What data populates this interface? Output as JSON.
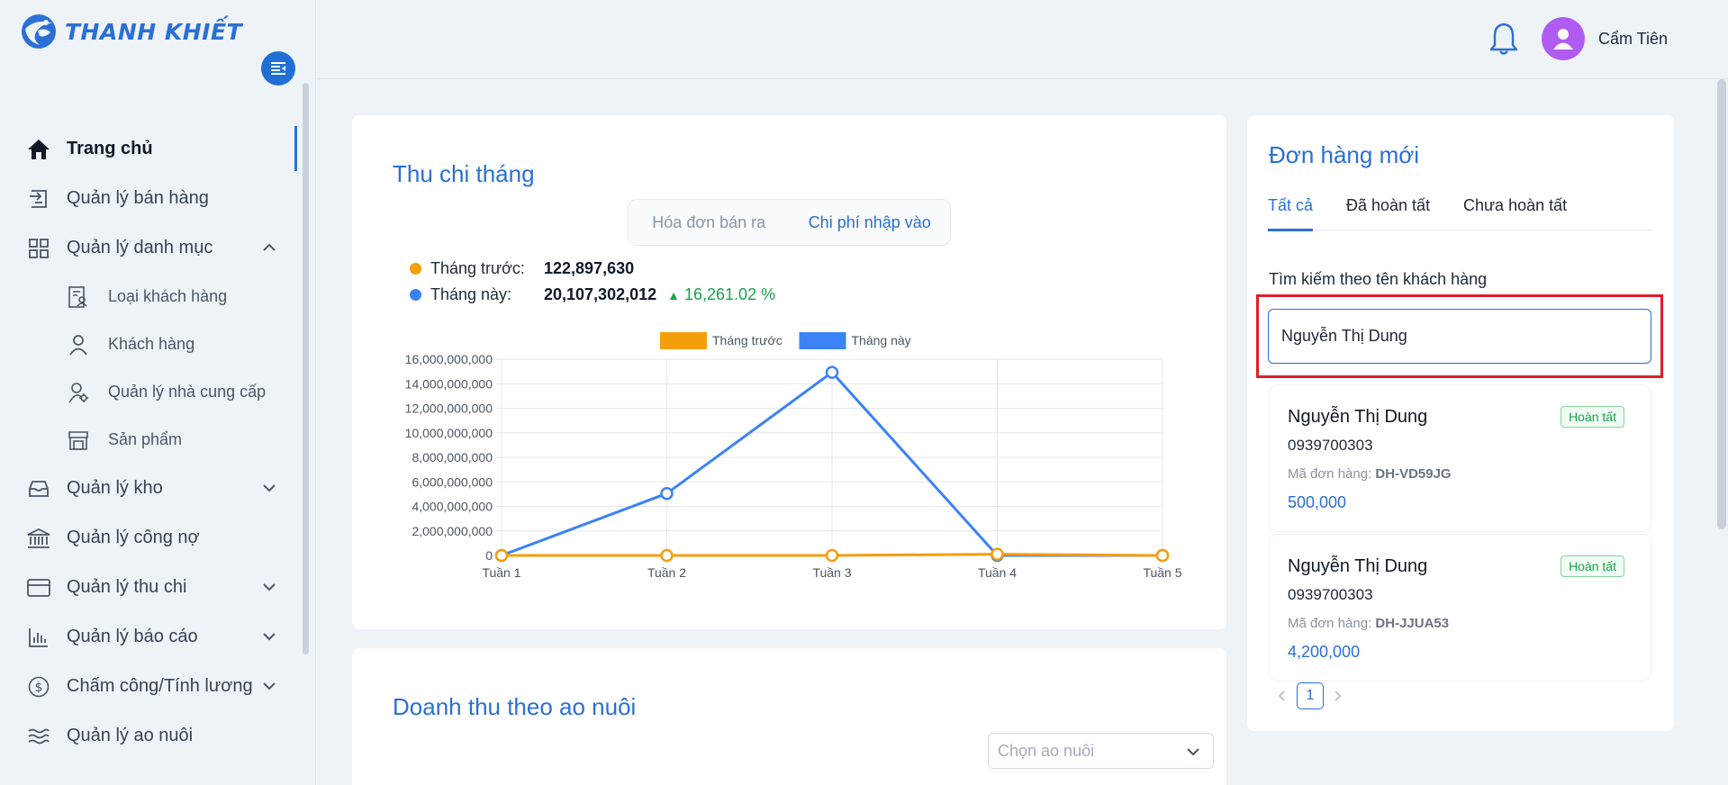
{
  "brand": {
    "name": "THANH KHIẾT",
    "color": "#2b6fd6"
  },
  "sidebar": {
    "items": [
      {
        "label": "Trang chủ",
        "icon": "home-icon",
        "active": true
      },
      {
        "label": "Quản lý bán hàng",
        "icon": "sales-icon"
      },
      {
        "label": "Quản lý danh mục",
        "icon": "grid-icon",
        "expanded": true,
        "children": [
          {
            "label": "Loại khách hàng",
            "icon": "customer-type-icon"
          },
          {
            "label": "Khách hàng",
            "icon": "user-icon"
          },
          {
            "label": "Quản lý nhà cung cấp",
            "icon": "supplier-icon"
          },
          {
            "label": "Sản phẩm",
            "icon": "store-icon"
          }
        ]
      },
      {
        "label": "Quản lý kho",
        "icon": "inbox-icon"
      },
      {
        "label": "Quản lý công nợ",
        "icon": "bank-icon"
      },
      {
        "label": "Quản lý thu chi",
        "icon": "card-icon"
      },
      {
        "label": "Quản lý báo cáo",
        "icon": "bar-chart-icon"
      },
      {
        "label": "Chấm công/Tính lương",
        "icon": "dollar-icon"
      },
      {
        "label": "Quản lý ao nuôi",
        "icon": "waves-icon"
      }
    ]
  },
  "header": {
    "username": "Cẩm Tiên",
    "avatar_color": "#b05cf0"
  },
  "finance": {
    "title": "Thu chi tháng",
    "toggle": {
      "option1": "Hóa đơn bán ra",
      "option2": "Chi phí nhập vào",
      "selected": "Chi phí nhập vào"
    },
    "prev_label": "Tháng trước:",
    "prev_value": "122,897,630",
    "curr_label": "Tháng này:",
    "curr_value": "20,107,302,012",
    "change": "16,261.02 %"
  },
  "chart_data": {
    "type": "line",
    "categories": [
      "Tuần 1",
      "Tuần 2",
      "Tuần 3",
      "Tuần 4",
      "Tuần 5"
    ],
    "series": [
      {
        "name": "Tháng trước",
        "color": "#f59e0b",
        "values": [
          0,
          0,
          0,
          100000000,
          0
        ]
      },
      {
        "name": "Tháng này",
        "color": "#3b82f6",
        "values": [
          0,
          5050000000,
          14930000000,
          0,
          0
        ]
      }
    ],
    "yticks": [
      "16,000,000,000",
      "14,000,000,000",
      "12,000,000,000",
      "10,000,000,000",
      "8,000,000,000",
      "6,000,000,000",
      "4,000,000,000",
      "2,000,000,000",
      "0"
    ],
    "ylim": [
      0,
      16000000000
    ],
    "legend_position": "top",
    "grid": true
  },
  "revenue": {
    "title": "Doanh thu theo ao nuôi",
    "select_placeholder": "Chọn ao nuôi"
  },
  "orders": {
    "title": "Đơn hàng mới",
    "tabs": [
      "Tất cả",
      "Đã hoàn tất",
      "Chưa hoàn tất"
    ],
    "search_label": "Tìm kiếm theo tên khách hàng",
    "search_value": "Nguyễn Thị Dung",
    "code_label": "Mã đơn hàng:",
    "items": [
      {
        "name": "Nguyễn Thị Dung",
        "phone": "0939700303",
        "code": "DH-VD59JG",
        "amount": "500,000",
        "status": "Hoàn tất"
      },
      {
        "name": "Nguyễn Thị Dung",
        "phone": "0939700303",
        "code": "DH-JJUA53",
        "amount": "4,200,000",
        "status": "Hoàn tất"
      }
    ],
    "page": "1"
  }
}
